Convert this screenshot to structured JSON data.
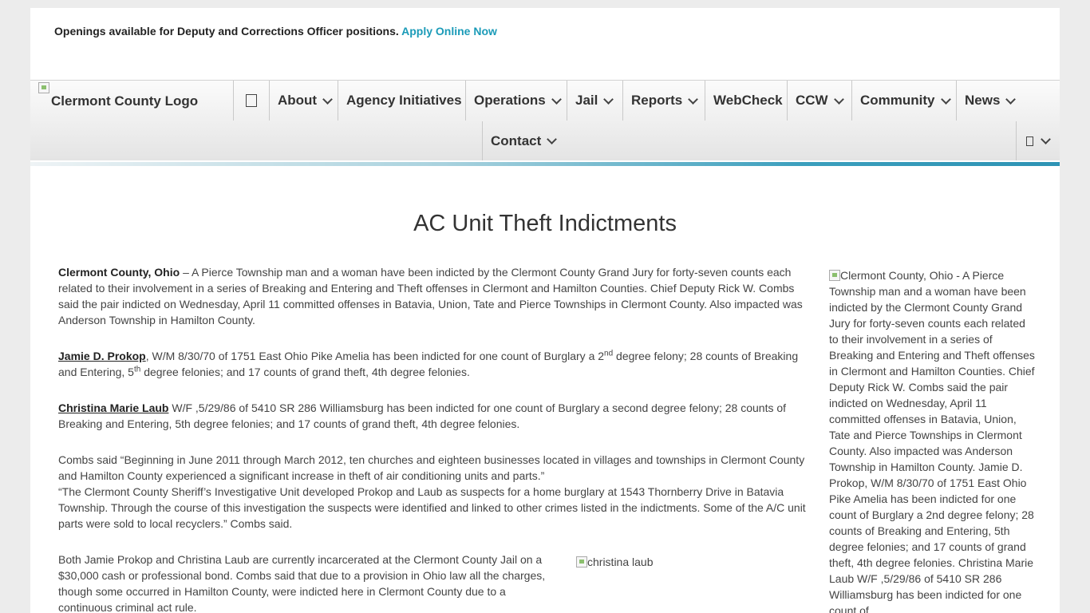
{
  "announcement": {
    "text": "Openings available for Deputy and Corrections Officer positions.",
    "link": "Apply Online Now"
  },
  "logo": {
    "alt": "Clermont County Logo"
  },
  "nav": {
    "items": [
      {
        "label": "About",
        "dropdown": true
      },
      {
        "label": "Agency Initiatives",
        "dropdown": false
      },
      {
        "label": "Operations",
        "dropdown": true
      },
      {
        "label": "Jail",
        "dropdown": true
      },
      {
        "label": "Reports",
        "dropdown": true
      },
      {
        "label": "WebCheck",
        "dropdown": false
      },
      {
        "label": "CCW",
        "dropdown": true
      },
      {
        "label": "Community",
        "dropdown": true
      },
      {
        "label": "News",
        "dropdown": true
      },
      {
        "label": "Contact",
        "dropdown": true
      }
    ]
  },
  "article": {
    "title": "AC Unit Theft Indictments",
    "p1_lead": "Clermont County, Ohio",
    "p1_text": " – A Pierce Township man and a woman have been indicted by the Clermont County Grand Jury for forty-seven counts each related to their involvement in a series of Breaking and Entering and Theft offenses in Clermont and Hamilton Counties. Chief Deputy Rick W. Combs said the pair indicted on Wednesday, April 11 committed offenses in Batavia, Union, Tate and Pierce Townships in Clermont County.  Also impacted was Anderson Township in Hamilton County.",
    "p2_name": "Jamie D. Prokop",
    "p2_a": ", W/M 8/30/70 of 1751 East Ohio Pike Amelia has been indicted for one count of Burglary a 2",
    "p2_sup1": "nd",
    "p2_b": " degree felony; 28 counts of Breaking and Entering, 5",
    "p2_sup2": "th",
    "p2_c": " degree felonies; and 17 counts of grand theft, 4th degree felonies.",
    "p3_name": "Christina Marie Laub",
    "p3_text": " W/F ,5/29/86 of 5410 SR 286 Williamsburg has been indicted for one count of Burglary a second degree felony; 28 counts of Breaking and Entering, 5th degree felonies; and 17 counts of grand theft, 4th degree felonies.",
    "p4_line1": "Combs said “Beginning in June 2011 through March 2012, ten churches and eighteen businesses located in villages and townships in Clermont County and Hamilton County experienced a significant increase in theft of air conditioning units and parts.”",
    "p4_line2": "“The Clermont County Sheriff’s Investigative Unit developed Prokop and Laub as suspects for a home burglary at 1543 Thornberry Drive in Batavia Township. Through the course of this investigation the suspects were identified and linked to other crimes listed in the indictments. Some of the A/C unit parts were sold to local recyclers.” Combs said.",
    "p5": "Both Jamie Prokop and Christina Laub are currently incarcerated at the Clermont County Jail on a $30,000 cash or professional bond. Combs said that due to a provision in Ohio law all the charges, though some occurred in Hamilton County, were indicted here in Clermont County due to a continuous criminal act rule.",
    "inline_image_alt": "christina laub",
    "sidebar_image_alt": "Clermont County, Ohio - A Pierce Township man and a woman have been indicted by the Clermont County Grand Jury for forty-seven counts each related to their involvement in a series of Breaking and Entering and Theft offenses in Clermont and Hamilton Counties. Chief Deputy Rick W. Combs said the pair indicted on Wednesday, April 11 committed offenses in Batavia, Union, Tate and Pierce Townships in Clermont County. Also impacted was Anderson Township in Hamilton County. Jamie D. Prokop, W/M 8/30/70 of 1751 East Ohio Pike Amelia has been indicted for one count of Burglary a 2nd degree felony; 28 counts of Breaking and Entering, 5th degree felonies; and 17 counts of grand theft, 4th degree felonies. Christina Marie Laub W/F ,5/29/86 of 5410 SR 286 Williamsburg has been indicted for one count of"
  }
}
